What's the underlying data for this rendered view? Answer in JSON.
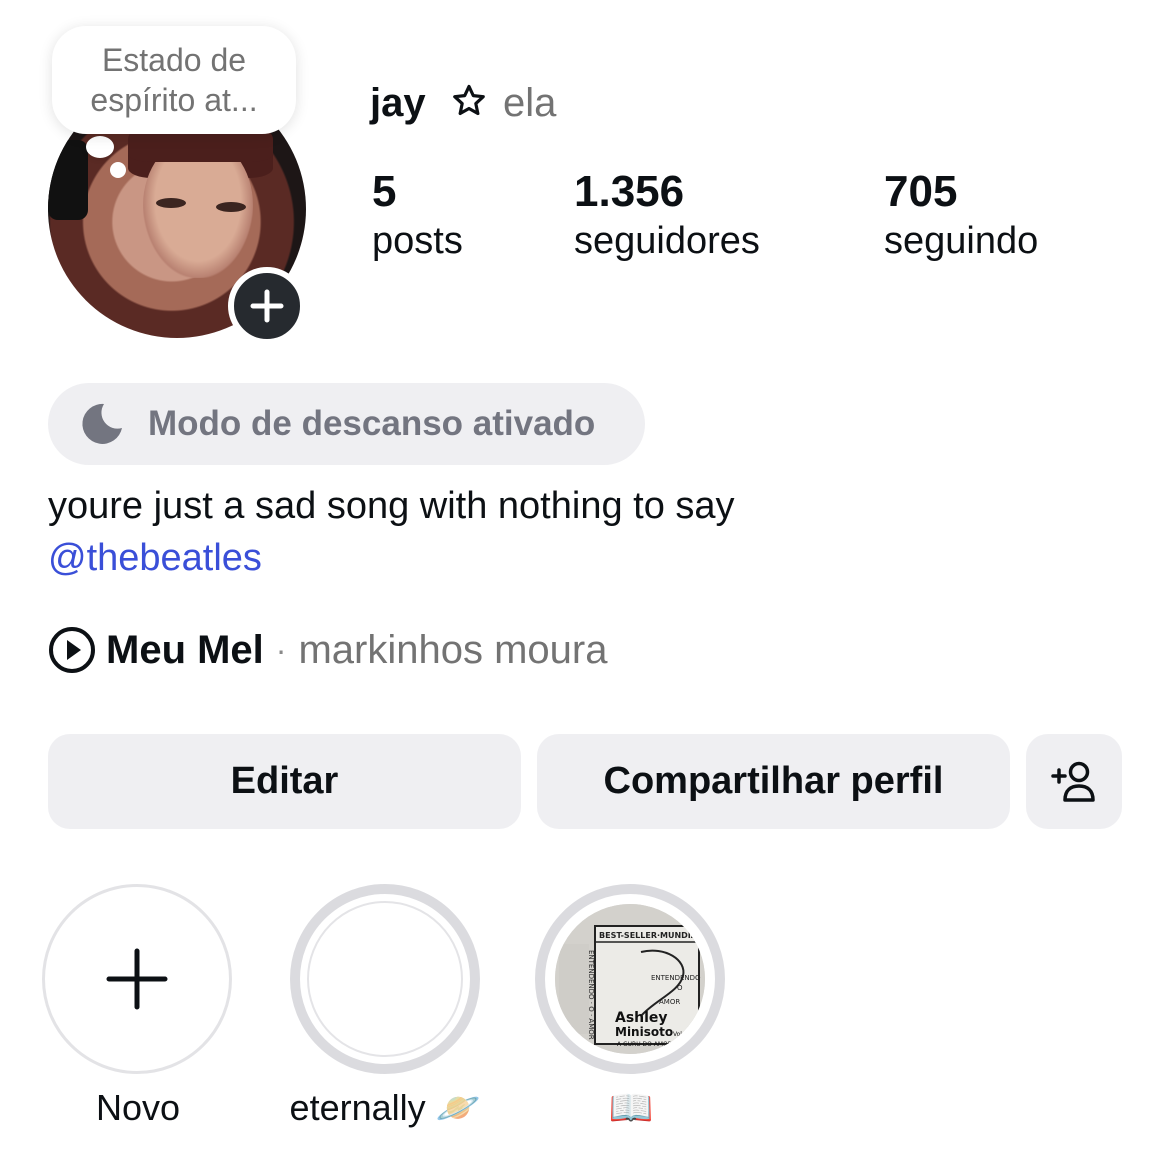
{
  "profile": {
    "note": "Estado de espírito at...",
    "note_line1": "Estado de",
    "note_line2": "espírito at...",
    "username": "jay",
    "pronouns": "ela",
    "stats": [
      {
        "value": "5",
        "label": "posts"
      },
      {
        "value": "1.356",
        "label": "seguidores"
      },
      {
        "value": "705",
        "label": "seguindo"
      }
    ],
    "rest_mode": "Modo de descanso ativado",
    "bio": "youre just a sad song with nothing to say",
    "mention": "@thebeatles",
    "music": {
      "song": "Meu Mel",
      "separator": "·",
      "artist": "markinhos moura"
    }
  },
  "actions": {
    "edit": "Editar",
    "share": "Compartilhar perfil"
  },
  "highlights": [
    {
      "label": "Novo",
      "icon": "plus-icon"
    },
    {
      "label": "eternally 🪐",
      "icon": "empty-ring"
    },
    {
      "label": "📖",
      "icon": "book-cover-thumbnail"
    }
  ],
  "thumbnail_text": {
    "top": "BEST-SELLER·MUNDIAL",
    "side": "ENTENDENDO · O · AMOR",
    "mid": "ENTENDENDO",
    "mid2": "O",
    "amor": "AMOR",
    "author1": "Ashley",
    "author2": "Minisoto",
    "sub": "A GURU DO AMOR",
    "vol": "Vol.1"
  },
  "colors": {
    "link": "#3a4fd8",
    "button_bg": "#efeff2",
    "secondary_text": "#737373"
  }
}
